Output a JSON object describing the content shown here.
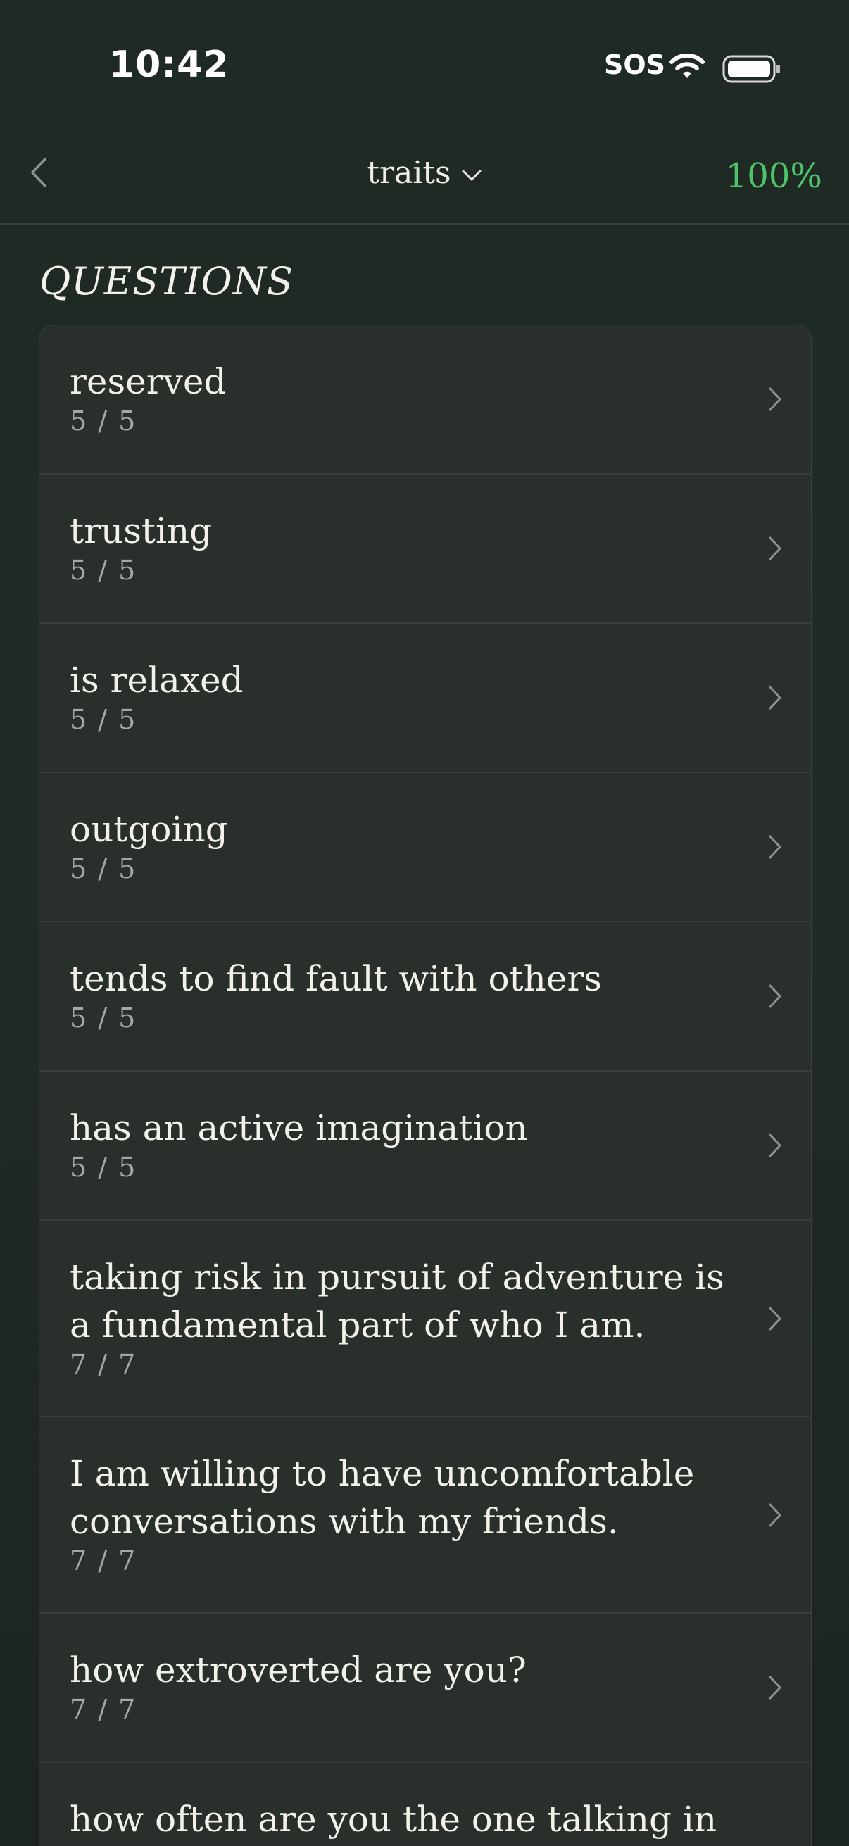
{
  "status_bar": {
    "time": "10:42",
    "carrier": "SOS",
    "icons": [
      "wifi-icon",
      "battery-icon"
    ]
  },
  "nav": {
    "back_icon": "chevron-left-icon",
    "title": "traits",
    "title_icon": "chevron-down-icon",
    "progress": "100%"
  },
  "section": {
    "header": "QUESTIONS"
  },
  "questions": [
    {
      "title": "reserved",
      "count": "5 / 5"
    },
    {
      "title": "trusting",
      "count": "5 / 5"
    },
    {
      "title": "is relaxed",
      "count": "5 / 5"
    },
    {
      "title": "outgoing",
      "count": "5 / 5"
    },
    {
      "title": "tends to find fault with others",
      "count": "5 / 5"
    },
    {
      "title": "has an active imagination",
      "count": "5 / 5"
    },
    {
      "title": "taking risk in pursuit of adventure is a fundamental part of who I am.",
      "count": "7 / 7"
    },
    {
      "title": "I am willing to have uncomfortable conversations with my friends.",
      "count": "7 / 7"
    },
    {
      "title": "how extroverted are you?",
      "count": "7 / 7"
    },
    {
      "title": "how often are you the one talking in",
      "count": ""
    }
  ],
  "colors": {
    "accent": "#4fc36a",
    "background": "#1f2a24",
    "card": "#29302b"
  }
}
